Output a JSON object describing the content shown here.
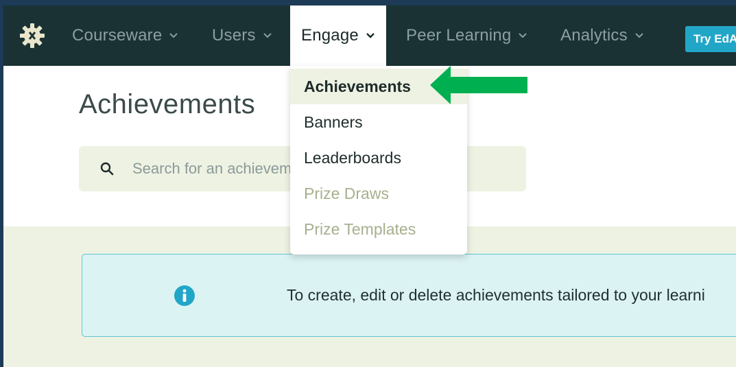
{
  "nav": {
    "items": [
      {
        "label": "Courseware"
      },
      {
        "label": "Users"
      },
      {
        "label": "Engage"
      },
      {
        "label": "Peer Learning"
      },
      {
        "label": "Analytics"
      }
    ],
    "try_button": "Try EdA"
  },
  "page": {
    "title": "Achievements",
    "search_placeholder": "Search for an achievement",
    "notice_text": "To create, edit or delete achievements tailored to your learni"
  },
  "dropdown": {
    "items": [
      {
        "label": "Achievements",
        "state": "selected"
      },
      {
        "label": "Banners",
        "state": "enabled"
      },
      {
        "label": "Leaderboards",
        "state": "enabled"
      },
      {
        "label": "Prize Draws",
        "state": "disabled"
      },
      {
        "label": "Prize Templates",
        "state": "disabled"
      }
    ]
  },
  "colors": {
    "nav_bg": "#1a3233",
    "accent_green_arrow": "#00b050",
    "info_blue": "#22a6c7",
    "notice_bg": "#dcf3f3",
    "band_bg": "#eef2e2"
  },
  "icons": {
    "logo": "gear-logo-icon",
    "search": "search-icon",
    "info": "info-icon",
    "arrow": "green-arrow-annotation"
  }
}
